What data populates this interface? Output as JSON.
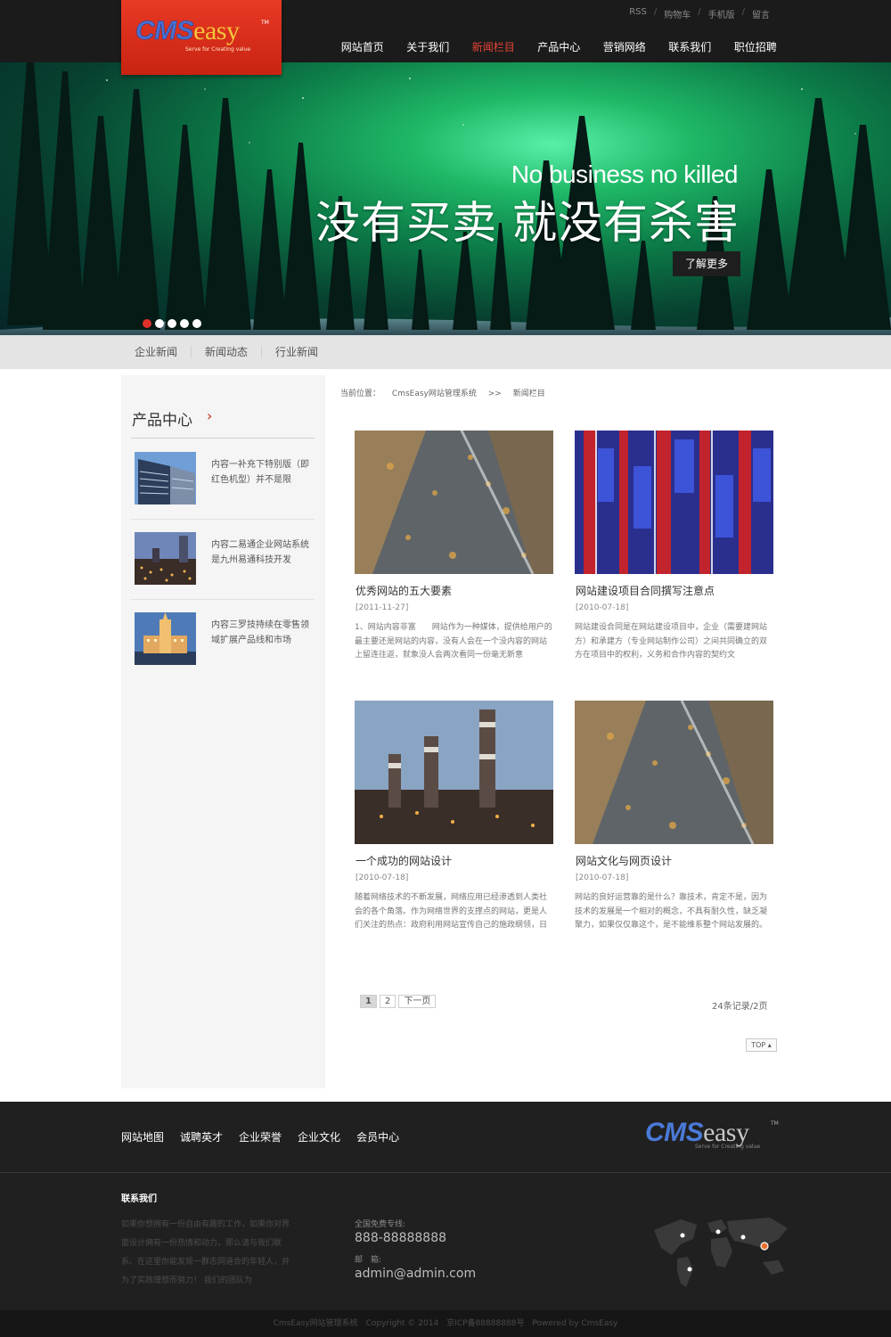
{
  "header": {
    "logo": {
      "cms": "CMS",
      "easy": "easy",
      "tm": "TM",
      "tagline": "Serve for Creating value"
    },
    "toplinks": [
      "RSS",
      "购物车",
      "手机版",
      "留言"
    ],
    "nav": [
      "网站首页",
      "关于我们",
      "新闻栏目",
      "产品中心",
      "营销网络",
      "联系我们",
      "职位招聘"
    ],
    "active_nav": "新闻栏目"
  },
  "banner": {
    "headline_en": "No business no killed",
    "headline_cn": "没有买卖 就没有杀害",
    "button": "了解更多",
    "slides": 5,
    "active_slide": 1
  },
  "subnav": [
    "企业新闻",
    "新闻动态",
    "行业新闻"
  ],
  "sidebar": {
    "title": "产品中心",
    "arrow": "›",
    "items": [
      {
        "text": "内容一补充下特别版（即红色机型）并不是限"
      },
      {
        "text": "内容二易通企业网站系统是九州易通科技开发"
      },
      {
        "text": "内容三罗技持续在零售领域扩展产品线和市场"
      }
    ]
  },
  "breadcrumb": [
    "当前位置：",
    "CmsEasy网站管理系统",
    ">>",
    "新闻栏目"
  ],
  "articles": [
    {
      "title": "优秀网站的五大要素",
      "date": "[2011-11-27]",
      "desc": "1、网站内容非富　　网站作为一种媒体，提供给用户的最主要还是网站的内容，没有人会在一个没内容的网站上留连往返，就象没人会两次看同一份毫无新意"
    },
    {
      "title": "网站建设项目合同撰写注意点",
      "date": "[2010-07-18]",
      "desc": "网站建设合同是在网站建设项目中，企业（需要建网站方）和承建方（专业网站制作公司）之间共同确立的双方在项目中的权利，义务和合作内容的契约文"
    },
    {
      "title": "一个成功的网站设计",
      "date": "[2010-07-18]",
      "desc": "随着网络技术的不断发展，网络应用已经渗透到人类社会的各个角落。作为网络世界的支撑点的网站，更是人们关注的热点：政府利用网站宣传自己的施政纲领，日"
    },
    {
      "title": "网站文化与网页设计",
      "date": "[2010-07-18]",
      "desc": "网站的良好运营靠的是什么？靠技术，肯定不是，因为技术的发展是一个相对的概念，不具有耐久性，缺乏凝聚力，如果仅仅靠这个，是不能维系整个网站发展的。"
    }
  ],
  "pagination": {
    "pages": [
      "1",
      "2"
    ],
    "current": "1",
    "next": "下一页",
    "info": "24条记录/2页"
  },
  "top_button": "TOP ▴",
  "footer": {
    "links": [
      "网站地图",
      "诚聘英才",
      "企业荣誉",
      "企业文化",
      "会员中心"
    ],
    "contact_title": "联系我们",
    "about": "如果你想拥有一份自由有趣的工作，如果你对界面设计拥有一份热情和动力，那么请与我们联系。在这里你能发现一群志同道合的年轻人，并为了实践理想而努力！ 我们的团队为",
    "hotline_label": "全国免费专线:",
    "hotline": "888-88888888",
    "email_label": "邮　箱:",
    "email": "admin@admin.com",
    "copyright": "CmsEasy网站管理系统　Copyright © 2014　京ICP备88888888号　Powered by CmsEasy"
  },
  "colors": {
    "accent": "#e64434",
    "logo_red": "#d8301c",
    "header_bg": "#1b1b1b",
    "footer_bg": "#202020"
  }
}
